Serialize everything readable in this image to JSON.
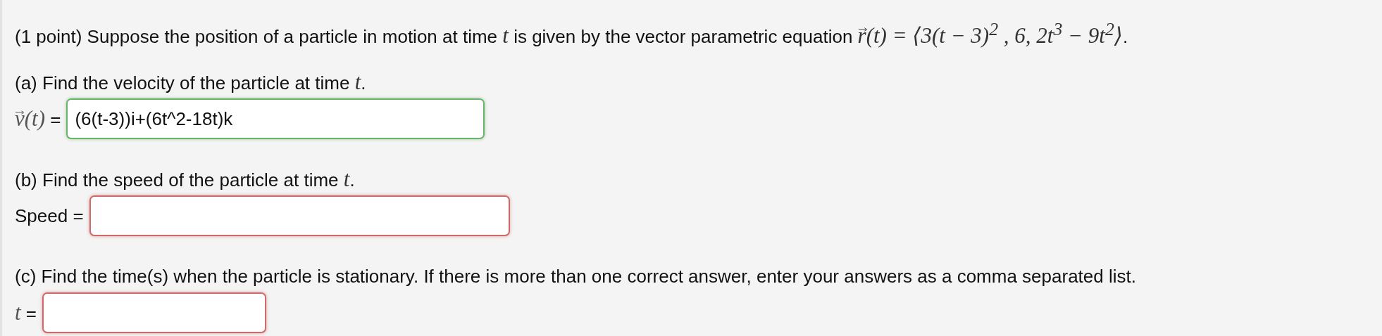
{
  "intro": [
    {
      "kind": "text",
      "text": "(1 point) Suppose the position of a particle in motion at time "
    },
    {
      "kind": "math",
      "text": "t"
    },
    {
      "kind": "text",
      "text": " is given by the vector parametric equation "
    },
    {
      "kind": "vec",
      "text": "r"
    },
    {
      "kind": "math",
      "text": "(t) = ⟨3(t − 3)$^{2}$ , 6, 2t$^{3}$ − 9t$^{2}$⟩"
    },
    {
      "kind": "text",
      "text": "."
    }
  ],
  "parts": [
    {
      "prompt": [
        {
          "kind": "text",
          "text": "(a) Find the velocity of the particle at time "
        },
        {
          "kind": "math",
          "text": "t"
        },
        {
          "kind": "text",
          "text": "."
        }
      ],
      "label": [
        {
          "kind": "vec",
          "text": "v"
        },
        {
          "kind": "math",
          "text": "(t)"
        },
        {
          "kind": "text",
          "text": " ="
        }
      ],
      "answer": {
        "value": "(6(t-3))i+(6t^2-18t)k",
        "correct": true
      }
    },
    {
      "prompt": [
        {
          "kind": "text",
          "text": "(b) Find the speed of the particle at time "
        },
        {
          "kind": "math",
          "text": "t"
        },
        {
          "kind": "text",
          "text": "."
        }
      ],
      "label": [
        {
          "kind": "text",
          "text": "Speed ="
        }
      ],
      "answer": {
        "correct": false
      }
    },
    {
      "prompt": [
        {
          "kind": "text",
          "text": "(c) Find the time(s) when the particle is stationary. If there is more than one correct answer, enter your answers as a comma separated list."
        }
      ],
      "label": [
        {
          "kind": "math",
          "text": "t"
        },
        {
          "kind": "text",
          "text": " ="
        }
      ],
      "answer": {
        "correct": false
      }
    }
  ]
}
